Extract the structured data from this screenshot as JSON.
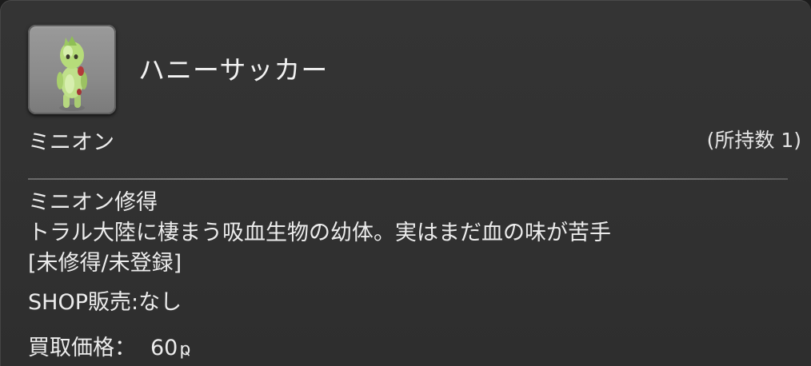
{
  "item": {
    "name": "ハニーサッカー",
    "icon": "minion-honey-sucker-icon",
    "category": "ミニオン",
    "owned": "(所持数 1)"
  },
  "details": {
    "action": "ミニオン修得",
    "description": "トラル大陸に棲まう吸血生物の幼体。実はまだ血の味が苦手",
    "status": "[未修得/未登録]",
    "shop": "SHOP販売:なし",
    "price_label": "買取価格：",
    "price_value": "60",
    "currency_symbol": "ҏ"
  },
  "colors": {
    "background": "#323232",
    "text": "#ececec",
    "icon_frame": "#8a8a8a"
  }
}
